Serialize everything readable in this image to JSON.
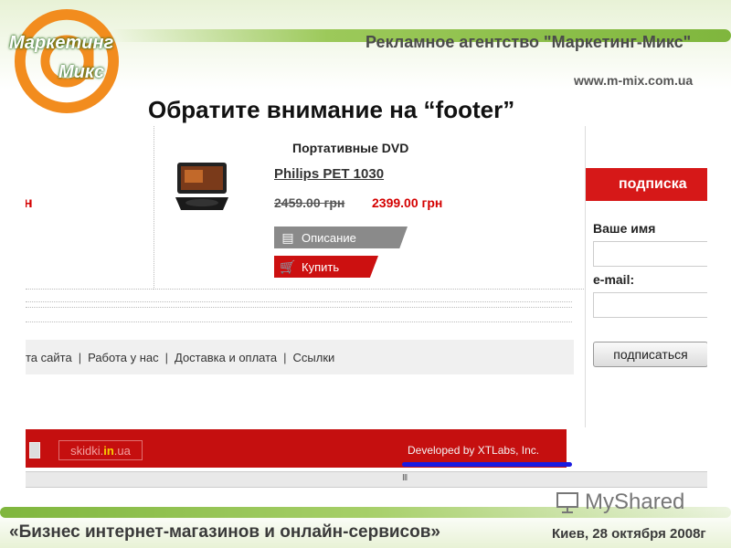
{
  "header": {
    "logo_line1": "Маркетинг",
    "logo_line2": "Микс",
    "agency": "Рекламное агентство \"Маркетинг-Микс\"",
    "url": "www.m-mix.com.ua"
  },
  "slide_title": "Обратите внимание на “footer”",
  "shop": {
    "left_fragment": "н",
    "category": "Портативные DVD",
    "product_name": "Philips PET 1030",
    "old_price": "2459.00 грн",
    "new_price": "2399.00 грн",
    "btn_description": "Описание",
    "btn_buy": "Купить",
    "footer_nav": [
      "та сайта",
      "Работа у нас",
      "Доставка и оплата",
      "Ссылки"
    ],
    "sidebar": {
      "subscribe_header": "подписка",
      "name_label": "Ваше имя",
      "email_label": "e-mail:",
      "subscribe_button": "подписаться"
    },
    "footer_logo_pre": "skidki.",
    "footer_logo_mid": "in",
    "footer_logo_post": ".ua",
    "developer": "Developed by XTLabs, Inc.",
    "scroll_grip": "III"
  },
  "bottom": {
    "slogan": "«Бизнес интернет-магазинов и онлайн-сервисов»",
    "date": "Киев, 28 октября 2008г",
    "watermark": "MyShared"
  },
  "colors": {
    "accent_red": "#c50f0f",
    "brand_green": "#7fb63d",
    "logo_orange": "#f28c1e",
    "highlight_blue": "#1a1ae0"
  }
}
